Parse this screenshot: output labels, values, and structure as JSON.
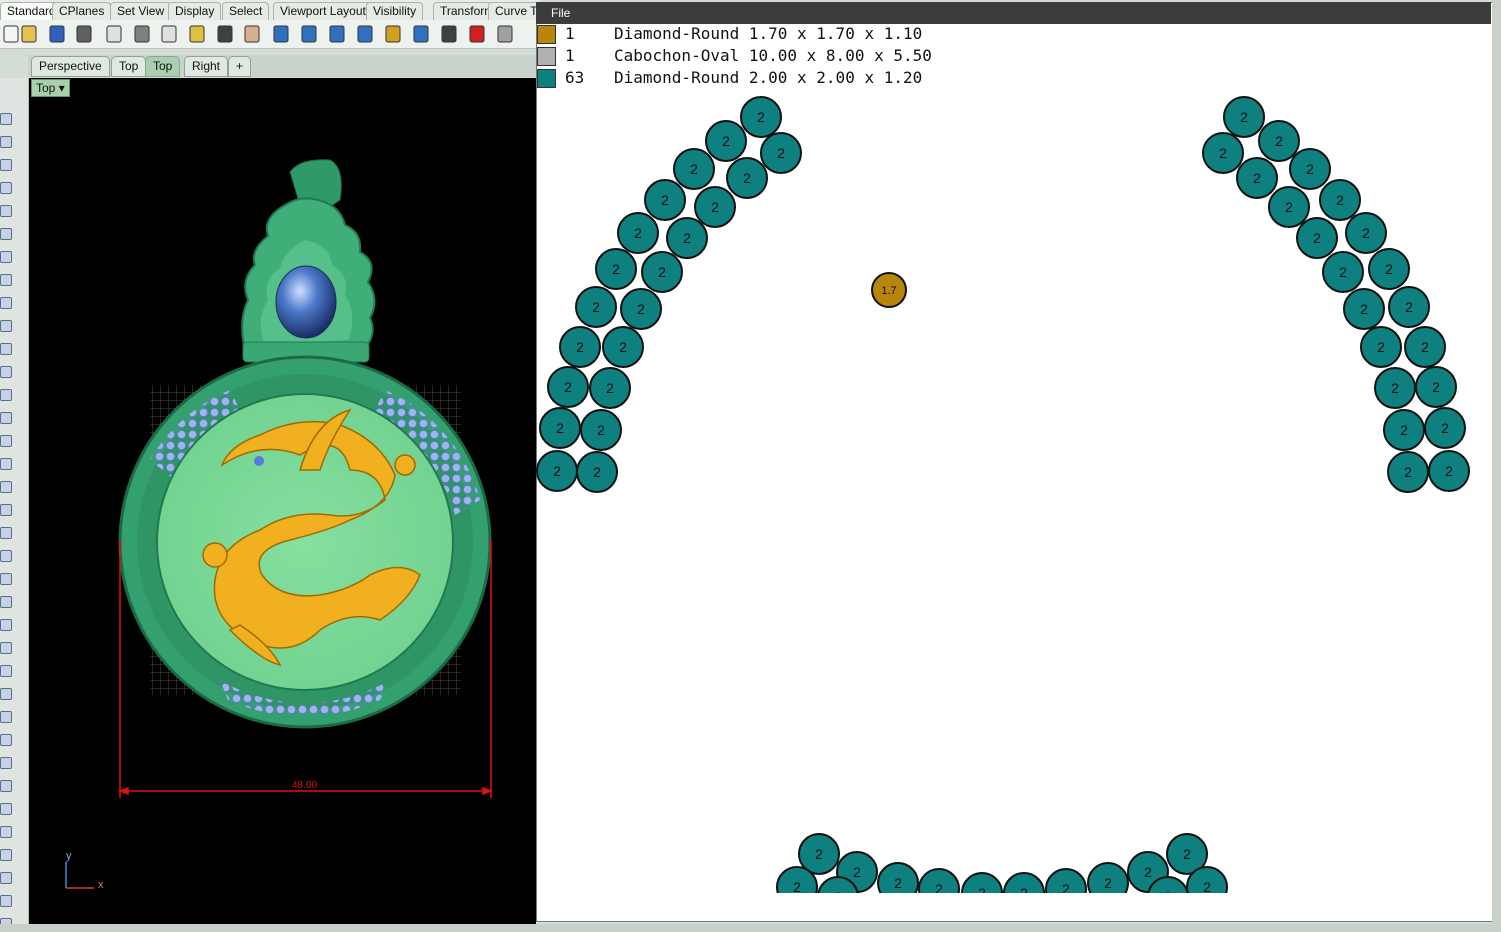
{
  "toolbar_tabs": [
    "Standard",
    "CPlanes",
    "Set View",
    "Display",
    "Select",
    "Viewport Layout",
    "Visibility",
    "Transform",
    "Curve T"
  ],
  "active_toolbar_tab": "Standard",
  "viewport_tabs": [
    "Perspective",
    "Top",
    "Top",
    "Right"
  ],
  "active_viewport_tab": "Top",
  "viewport": {
    "label": "Top",
    "dimension_label": "48.00",
    "axis_y": "y",
    "axis_x": "x"
  },
  "viewer": {
    "menu_file": "File",
    "legend": [
      {
        "count": "1",
        "desc": "Diamond-Round 1.70 x 1.70 x 1.10",
        "color": "#b8860b"
      },
      {
        "count": "1",
        "desc": "Cabochon-Oval 10.00 x 8.00 x 5.50",
        "color": "#b0b0b0"
      },
      {
        "count": "63",
        "desc": "Diamond-Round 2.00 x 2.00 x 1.20",
        "color": "#0e8080"
      }
    ],
    "stone_teal_label": "2",
    "stone_gold_label": "1.7",
    "teal_color": "#0e8080",
    "gold_color": "#b8860b"
  },
  "icons": [
    "new-icon",
    "open-icon",
    "save-icon",
    "print-icon",
    "import-icon",
    "cut-icon",
    "copy-icon",
    "paste-icon",
    "undo-icon",
    "pan-icon",
    "rotate-icon",
    "zoom-icon",
    "zoom-window-icon",
    "zoom-extents-icon",
    "zoom-selected-icon",
    "rotate-view-icon",
    "viewports-icon",
    "car-icon",
    "render-icon"
  ]
}
